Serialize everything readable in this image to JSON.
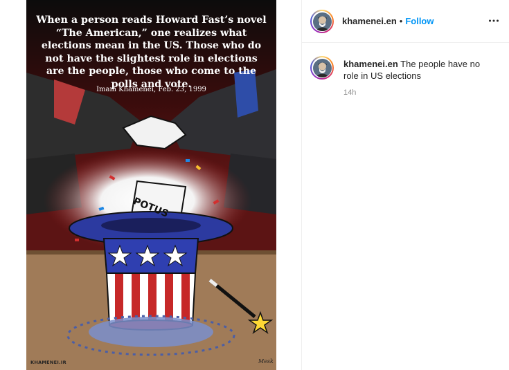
{
  "post": {
    "image": {
      "quote": "When a person reads Howard Fast’s novel “The American,” one realizes what elections mean in the US. Those who do not have the slightest role in elections are the people, those who come to the polls and vote.",
      "attribution": "Imam Khamenei, Feb. 23, 1999",
      "ballot_label": "POTUS",
      "watermark": "KHAMENEI.IR",
      "signature": "Mesk"
    }
  },
  "header": {
    "username": "khamenei.en",
    "separator": "•",
    "follow_label": "Follow",
    "more_icon": "more-horizontal-icon"
  },
  "caption": {
    "username": "khamenei.en",
    "text": "The people have no role in US elections",
    "time": "14h"
  },
  "colors": {
    "follow_blue": "#0095f6",
    "text_primary": "#262626",
    "text_secondary": "#8e8e8e"
  }
}
